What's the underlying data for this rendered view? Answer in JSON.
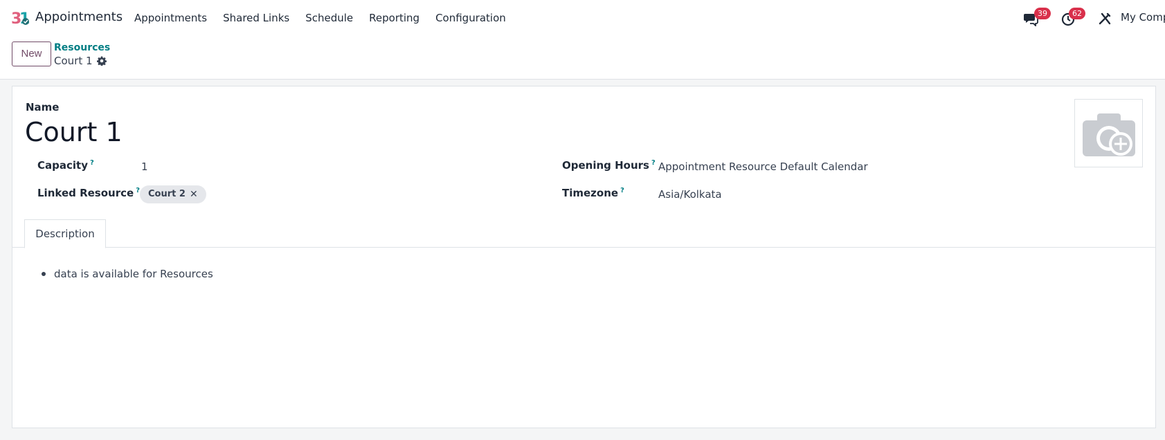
{
  "navbar": {
    "app_name": "Appointments",
    "menu": [
      "Appointments",
      "Shared Links",
      "Schedule",
      "Reporting",
      "Configuration"
    ],
    "messages_badge": "39",
    "activities_badge": "62",
    "company": "My Comp"
  },
  "control_panel": {
    "new_label": "New",
    "breadcrumb": "Resources",
    "current_record": "Court 1"
  },
  "form": {
    "name_label": "Name",
    "name_value": "Court 1",
    "capacity_label": "Capacity",
    "capacity_value": "1",
    "linked_resource_label": "Linked Resource",
    "linked_resource_tag": "Court 2",
    "opening_hours_label": "Opening Hours",
    "opening_hours_value": "Appointment Resource Default Calendar",
    "timezone_label": "Timezone",
    "timezone_value": "Asia/Kolkata",
    "help_mark": "?"
  },
  "tabs": {
    "active": "Description"
  },
  "description": {
    "items": [
      "data is available for Resources"
    ]
  },
  "colors": {
    "brand": "#714b67",
    "link": "#017e84",
    "badge": "#d9304b"
  }
}
